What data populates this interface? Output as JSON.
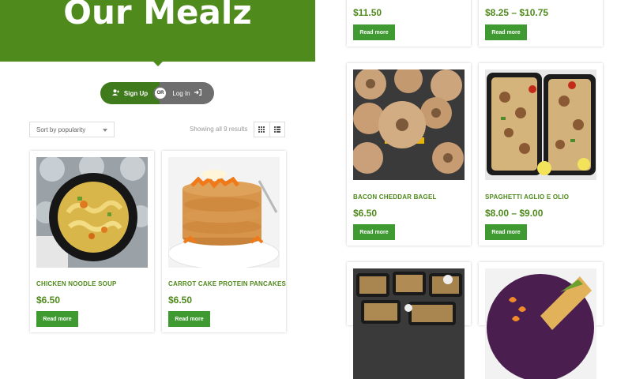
{
  "banner": {
    "title": "Our Mealz"
  },
  "auth": {
    "signup_label": "Sign Up",
    "or_label": "OR",
    "login_label": "Log In"
  },
  "shop": {
    "sort_value": "Sort by popularity",
    "result_count": "Showing all 9 results"
  },
  "read_more_label": "Read more",
  "products_left": [
    {
      "name": "CHICKEN NOODLE SOUP",
      "price": "$6.50"
    },
    {
      "name": "CARROT CAKE PROTEIN PANCAKES",
      "price": "$6.50"
    }
  ],
  "products_right_top": [
    {
      "price": "$11.50"
    },
    {
      "price": "$8.25 – $10.75"
    }
  ],
  "products_right_mid": [
    {
      "name": "BACON CHEDDAR BAGEL",
      "price": "$6.50"
    },
    {
      "name": "SPAGHETTI AGLIO E OLIO",
      "price": "$8.00 – $9.00"
    }
  ],
  "colors": {
    "brand_green": "#4f8a1c",
    "button_green": "#3f9a32",
    "toggle_gray": "#6e6e6e"
  }
}
